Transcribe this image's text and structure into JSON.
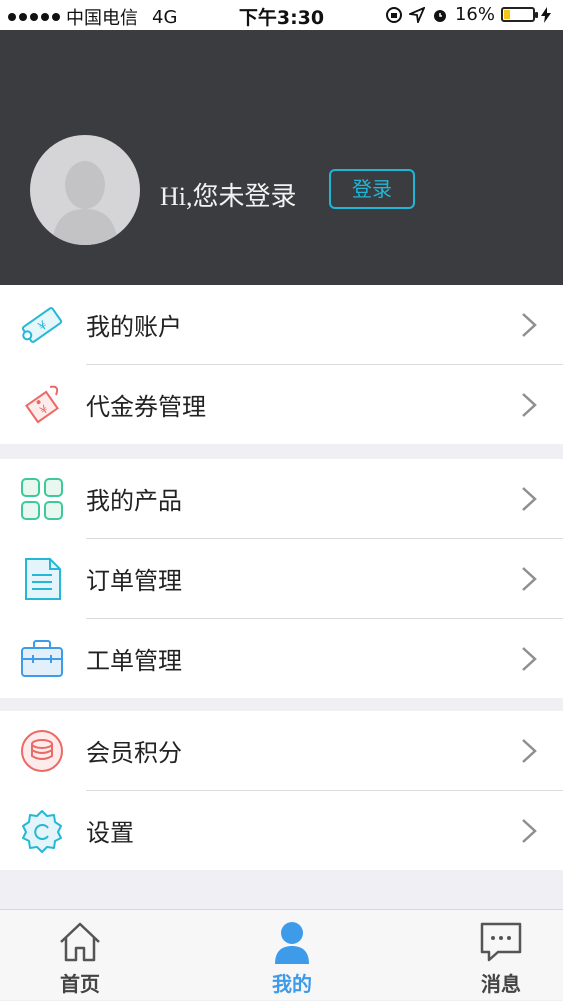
{
  "status_bar": {
    "carrier": "中国电信",
    "network": "4G",
    "time": "下午3:30",
    "battery": "16%"
  },
  "profile": {
    "greeting": "Hi,您未登录",
    "login_label": "登录"
  },
  "menu": {
    "group1": [
      {
        "label": "我的账户",
        "icon": "account-ticket-icon"
      },
      {
        "label": "代金券管理",
        "icon": "voucher-tag-icon"
      }
    ],
    "group2": [
      {
        "label": "我的产品",
        "icon": "products-grid-icon"
      },
      {
        "label": "订单管理",
        "icon": "order-document-icon"
      },
      {
        "label": "工单管理",
        "icon": "briefcase-icon"
      }
    ],
    "group3": [
      {
        "label": "会员积分",
        "icon": "coins-icon"
      },
      {
        "label": "设置",
        "icon": "settings-gear-icon"
      }
    ]
  },
  "tabs": [
    {
      "label": "首页",
      "icon": "home-icon"
    },
    {
      "label": "我的",
      "icon": "user-icon",
      "active": true
    },
    {
      "label": "消息",
      "icon": "message-icon"
    }
  ],
  "colors": {
    "accent": "#1fb7d8",
    "tab_active": "#3d9be9",
    "header_bg": "#3a3c3f",
    "page_bg": "#efeff4"
  }
}
